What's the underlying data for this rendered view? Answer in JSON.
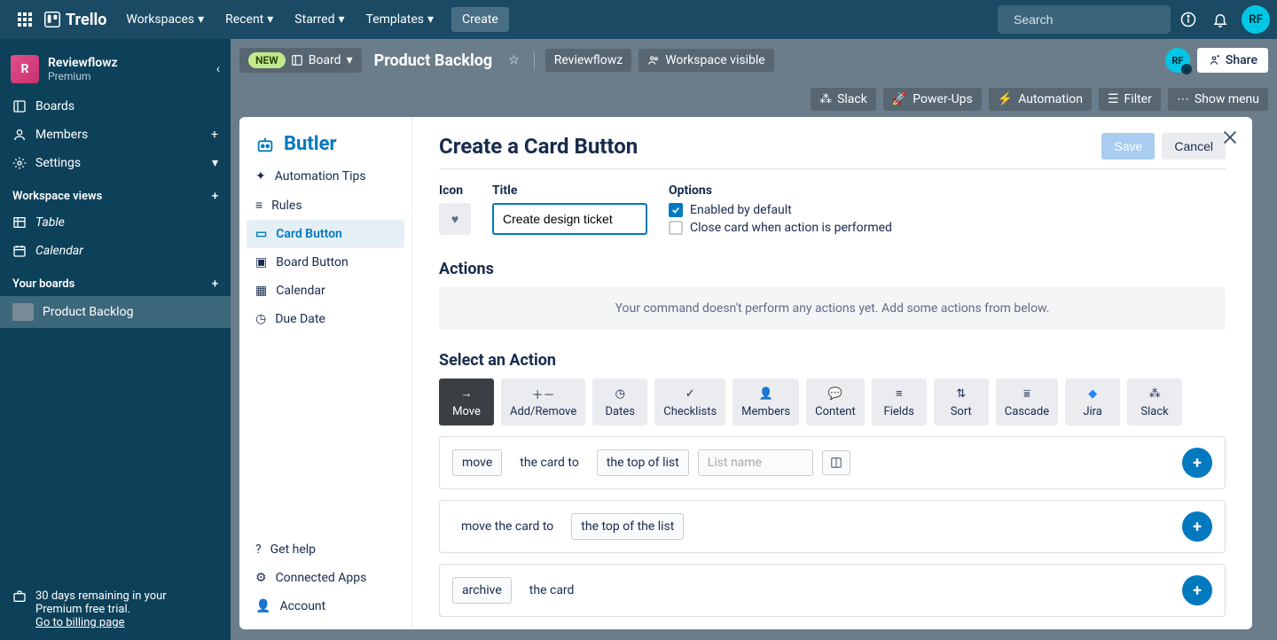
{
  "topnav": {
    "brand": "Trello",
    "menus": [
      "Workspaces",
      "Recent",
      "Starred",
      "Templates"
    ],
    "create": "Create",
    "search_placeholder": "Search",
    "avatar": "RF"
  },
  "sidebar": {
    "workspace": {
      "name": "Reviewflowz",
      "plan": "Premium",
      "initial": "R"
    },
    "nav": [
      {
        "icon": "board",
        "label": "Boards"
      },
      {
        "icon": "user",
        "label": "Members"
      },
      {
        "icon": "gear",
        "label": "Settings"
      }
    ],
    "views_label": "Workspace views",
    "views": [
      {
        "icon": "table",
        "label": "Table"
      },
      {
        "icon": "calendar",
        "label": "Calendar"
      }
    ],
    "boards_label": "Your boards",
    "boards": [
      {
        "label": "Product Backlog"
      }
    ],
    "trial": {
      "line1": "30 days remaining in your",
      "line2": "Premium free trial.",
      "link": "Go to billing page"
    }
  },
  "boardbar": {
    "new_tag": "NEW",
    "view_label": "Board",
    "title": "Product Backlog",
    "workspace": "Reviewflowz",
    "visibility": "Workspace visible",
    "member": "RF",
    "share": "Share",
    "row2": [
      "Slack",
      "Power-Ups",
      "Automation",
      "Filter",
      "Show menu"
    ]
  },
  "butler": {
    "title": "Butler",
    "nav": [
      "Automation Tips",
      "Rules",
      "Card Button",
      "Board Button",
      "Calendar",
      "Due Date"
    ],
    "footer": [
      "Get help",
      "Connected Apps",
      "Account"
    ],
    "panel": {
      "heading": "Create a Card Button",
      "save": "Save",
      "cancel": "Cancel",
      "icon_label": "Icon",
      "title_label": "Title",
      "title_value": "Create design ticket",
      "options_label": "Options",
      "opt1": "Enabled by default",
      "opt2": "Close card when action is performed",
      "actions_label": "Actions",
      "empty": "Your command doesn't perform any actions yet. Add some actions from below.",
      "select_action": "Select an Action",
      "action_tabs": [
        "Move",
        "Add/Remove",
        "Dates",
        "Checklists",
        "Members",
        "Content",
        "Fields",
        "Sort",
        "Cascade",
        "Jira",
        "Slack"
      ],
      "rules": [
        {
          "parts": [
            {
              "t": "move",
              "k": "tok"
            },
            {
              "t": "the card to",
              "k": "plain"
            },
            {
              "t": "the top of list",
              "k": "tok"
            },
            {
              "t": "List name",
              "k": "input"
            }
          ],
          "extra": "board"
        },
        {
          "parts": [
            {
              "t": "move the card to",
              "k": "plain"
            },
            {
              "t": "the top of the list",
              "k": "tok"
            }
          ]
        },
        {
          "parts": [
            {
              "t": "archive",
              "k": "tok"
            },
            {
              "t": "the card",
              "k": "plain"
            }
          ]
        }
      ]
    }
  }
}
